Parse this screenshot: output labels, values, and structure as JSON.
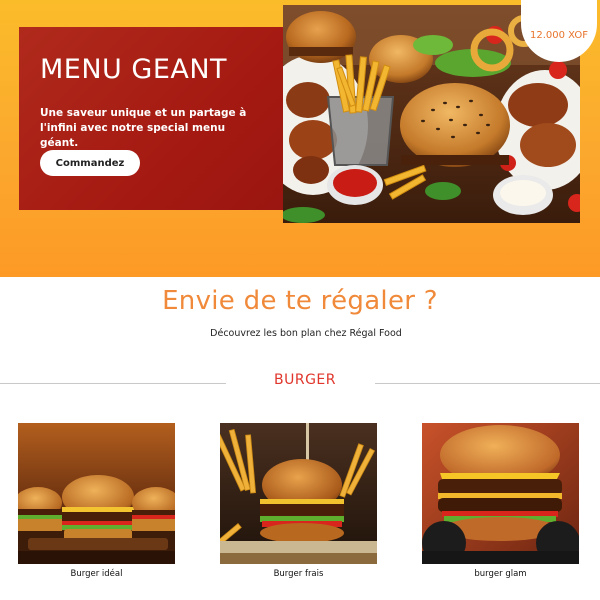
{
  "hero": {
    "title": "MENU GEANT",
    "description": "Une saveur unique et un partage à l'infini avec notre special menu géant.",
    "order_button": "Commandez",
    "price": "12.000 XOF",
    "photo_icon": "food-platter-photo"
  },
  "intro": {
    "title": "Envie de te régaler ?",
    "subtitle": "Découvrez les bon plan chez Régal Food"
  },
  "category": {
    "label": "BURGER"
  },
  "products": [
    {
      "name": "Burger idéal",
      "photo_icon": "burgers-trio-photo"
    },
    {
      "name": "Burger frais",
      "photo_icon": "burger-fries-photo"
    },
    {
      "name": "burger glam",
      "photo_icon": "gloved-burger-photo"
    }
  ],
  "colors": {
    "hero_gradient_top": "#fbbc2a",
    "hero_gradient_bottom": "#fd9a26",
    "promo_card": "#a51a12",
    "accent_orange": "#f08a3a",
    "category_red": "#e0362c"
  }
}
